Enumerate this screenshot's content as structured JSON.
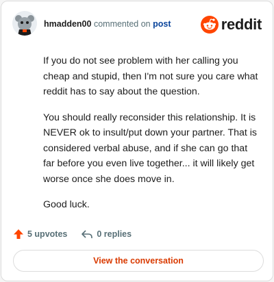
{
  "header": {
    "username": "hmadden00",
    "action_text": "commented on",
    "post_link": "post",
    "logo_text": "reddit"
  },
  "comment": {
    "paragraphs": [
      "If you do not see problem with her calling you cheap and stupid, then I'm not sure you care what reddit has to say about the question.",
      "You should really reconsider this relationship. It is NEVER ok to insult/put down your partner. That is considered verbal abuse, and if she can go that far before you even live together... it will likely get worse once she does move in.",
      "Good luck."
    ]
  },
  "footer": {
    "upvotes": "5 upvotes",
    "replies": "0 replies",
    "cta": "View the conversation"
  },
  "colors": {
    "brand": "#ff4500",
    "cta_text": "#d93a00",
    "link": "#0a449b",
    "muted": "#576f76"
  },
  "icons": [
    "avatar",
    "reddit-logo-icon",
    "upvote-arrow-icon",
    "reply-icon"
  ]
}
